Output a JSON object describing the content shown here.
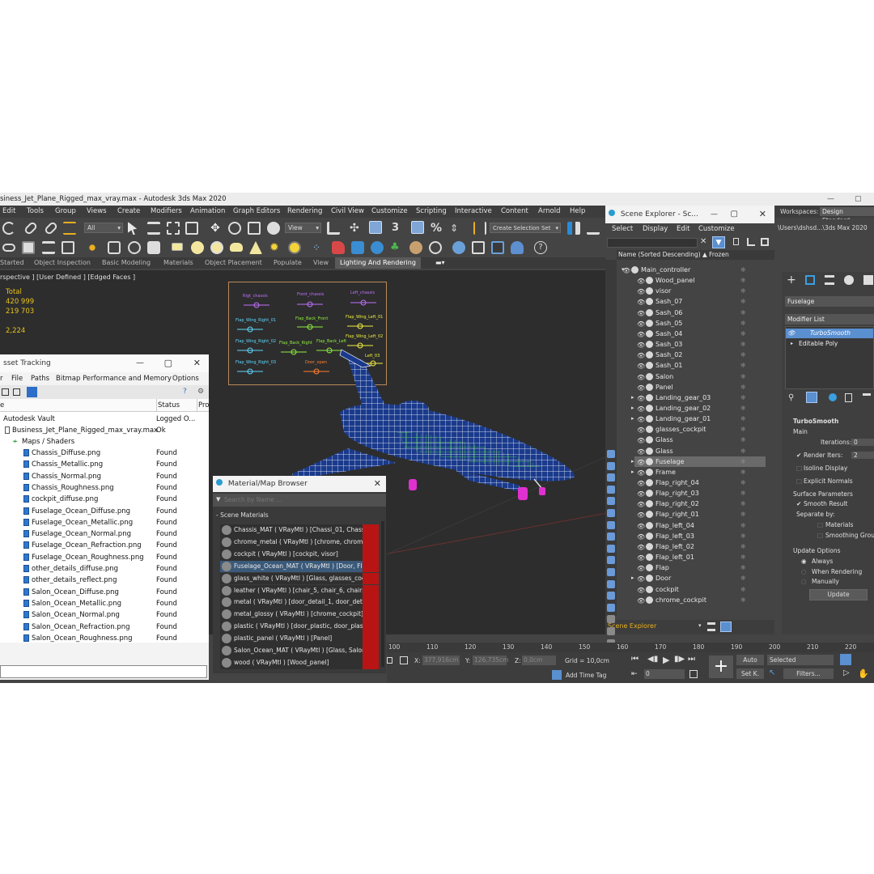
{
  "titlebar": {
    "title": "siness_Jet_Plane_Rigged_max_vray.max - Autodesk 3ds Max 2020"
  },
  "menu": [
    "Edit",
    "Tools",
    "Group",
    "Views",
    "Create",
    "Modifiers",
    "Animation",
    "Graph Editors",
    "Rendering",
    "Civil View",
    "Customize",
    "Scripting",
    "Interactive",
    "Content",
    "Arnold",
    "Help"
  ],
  "workspace": {
    "label": "Workspaces:",
    "value": "Design Standard",
    "path": "\\Users\\dshsd...\\3ds Max 2020"
  },
  "toolbar": {
    "filter": "All",
    "view": "View",
    "selection_set": "Create Selection Set"
  },
  "ribbon": [
    "Started",
    "Object Inspection",
    "Basic Modeling",
    "Materials",
    "Object Placement",
    "Populate",
    "View",
    "Lighting And Rendering"
  ],
  "viewport": {
    "label": "rspective ] [User Defined ] [Edged Faces ]",
    "stats": {
      "total": "Total",
      "v1": "420 999",
      "v2": "219 703",
      "v3": "2,224"
    }
  },
  "controller_board": {
    "labels": [
      "Rigt_chassis",
      "Front_chassis",
      "Left_chassis",
      "Flap_Wing_Right_01",
      "Flap_Back_Front",
      "Flap_Wing_Left_01",
      "Flap_Wing_Right_02",
      "Flap_Back_Right",
      "Flap_Back_Left",
      "Flap_Wing_Left_02",
      "Flap_Wing_Right_03",
      "Door_open",
      "Left_03"
    ]
  },
  "asset_tracking": {
    "title": "sset Tracking",
    "menu": [
      "r",
      "File",
      "Paths",
      "Bitmap Performance and Memory",
      "Options"
    ],
    "col_name": "e",
    "col_status": "Status",
    "col_pro": "Pro",
    "vault": {
      "name": "Autodesk Vault",
      "status": "Logged O..."
    },
    "file": {
      "name": "Business_Jet_Plane_Rigged_max_vray.max",
      "status": "Ok"
    },
    "folder": "Maps / Shaders",
    "maps": [
      {
        "name": "Chassis_Diffuse.png",
        "status": "Found"
      },
      {
        "name": "Chassis_Metallic.png",
        "status": "Found"
      },
      {
        "name": "Chassis_Normal.png",
        "status": "Found"
      },
      {
        "name": "Chassis_Roughness.png",
        "status": "Found"
      },
      {
        "name": "cockpit_diffuse.png",
        "status": "Found"
      },
      {
        "name": "Fuselage_Ocean_Diffuse.png",
        "status": "Found"
      },
      {
        "name": "Fuselage_Ocean_Metallic.png",
        "status": "Found"
      },
      {
        "name": "Fuselage_Ocean_Normal.png",
        "status": "Found"
      },
      {
        "name": "Fuselage_Ocean_Refraction.png",
        "status": "Found"
      },
      {
        "name": "Fuselage_Ocean_Roughness.png",
        "status": "Found"
      },
      {
        "name": "other_details_diffuse.png",
        "status": "Found"
      },
      {
        "name": "other_details_reflect.png",
        "status": "Found"
      },
      {
        "name": "Salon_Ocean_Diffuse.png",
        "status": "Found"
      },
      {
        "name": "Salon_Ocean_Metallic.png",
        "status": "Found"
      },
      {
        "name": "Salon_Ocean_Normal.png",
        "status": "Found"
      },
      {
        "name": "Salon_Ocean_Refraction.png",
        "status": "Found"
      },
      {
        "name": "Salon_Ocean_Roughness.png",
        "status": "Found"
      }
    ]
  },
  "material_browser": {
    "title": "Material/Map Browser",
    "search_placeholder": "Search by Name ...",
    "section": "- Scene Materials",
    "materials": [
      "Chassis_MAT  ( VRayMtl ) [Chassi_01, Chassi_...",
      "chrome_metal  ( VRayMtl ) [chrome, chrome_c...",
      "cockpit  ( VRayMtl ) [cockpit, visor]",
      "Fuselage_Ocean_MAT  ( VRayMtl ) [Door, Flap...",
      "glass_white  ( VRayMtl ) [Glass, glasses_cockpit]",
      "leather  ( VRayMtl ) [chair_5, chair_6, chairs_1...",
      "metal  ( VRayMtl ) [door_detail_1, door_detail...",
      "metal_glossy  ( VRayMtl ) [chrome_cockpit]",
      "plastic  ( VRayMtl ) [door_plastic, door_plastic...",
      "plastic_panel  ( VRayMtl ) [Panel]",
      "Salon_Ocean_MAT  ( VRayMtl ) [Glass, Salon,...",
      "wood  ( VRayMtl ) [Wood_panel]"
    ]
  },
  "scene_explorer": {
    "title": "Scene Explorer - Sc...",
    "menu": [
      "Select",
      "Display",
      "Edit",
      "Customize"
    ],
    "col_name": "Name (Sorted Descending)",
    "col_frozen": "▲ Frozen",
    "items": [
      "Main_controller",
      "Wood_panel",
      "visor",
      "Sash_07",
      "Sash_06",
      "Sash_05",
      "Sash_04",
      "Sash_03",
      "Sash_02",
      "Sash_01",
      "Salon",
      "Panel",
      "Landing_gear_03",
      "Landing_gear_02",
      "Landing_gear_01",
      "glasses_cockpit",
      "Glass",
      "Glass",
      "Fuselage",
      "Frame",
      "Flap_right_04",
      "Flap_right_03",
      "Flap_right_02",
      "Flap_right_01",
      "Flap_left_04",
      "Flap_left_03",
      "Flap_left_02",
      "Flap_left_01",
      "Flap",
      "Door",
      "cockpit",
      "chrome_cockpit"
    ],
    "footer": "Scene Explorer"
  },
  "command_panel": {
    "object_name": "Fuselage",
    "modifier_list": "Modifier List",
    "stack": [
      "TurboSmooth",
      "Editable Poly"
    ],
    "rollout": "TurboSmooth",
    "main": "Main",
    "iterations_label": "Iterations:",
    "iterations_value": "0",
    "render_iters_label": "Render Iters:",
    "render_iters_value": "2",
    "isoline": "Isoline Display",
    "explicit": "Explicit Normals",
    "surface_params": "Surface Parameters",
    "smooth_result": "Smooth Result",
    "separate_by": "Separate by:",
    "materials": "Materials",
    "smoothing_groups": "Smoothing Groups",
    "update_options": "Update Options",
    "always": "Always",
    "when_rendering": "When Rendering",
    "manually": "Manually",
    "update_btn": "Update"
  },
  "ruler": [
    "100",
    "110",
    "120",
    "130",
    "140",
    "150",
    "160",
    "170",
    "180",
    "190",
    "200",
    "210",
    "220"
  ],
  "status": {
    "x_label": "X:",
    "x": "377,916cm",
    "y_label": "Y:",
    "y": "126,735cm",
    "z_label": "Z:",
    "z": "0,0cm",
    "grid": "Grid = 10,0cm",
    "add_time_tag": "Add Time Tag",
    "frame": "0",
    "auto": "Auto",
    "selected": "Selected",
    "set_k": "Set K.",
    "filters": "Filters..."
  }
}
